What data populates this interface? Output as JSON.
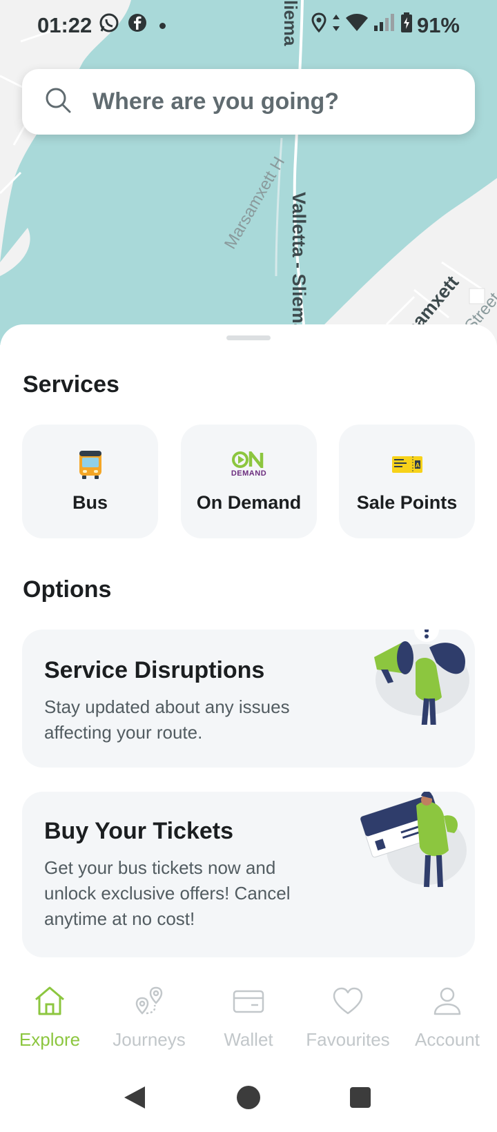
{
  "status_bar": {
    "time": "01:22",
    "battery": "91%",
    "icons": [
      "whatsapp-icon",
      "facebook-icon",
      "location-icon",
      "data-arrows-icon",
      "wifi-icon",
      "signal-icon",
      "battery-icon"
    ]
  },
  "map": {
    "labels": {
      "road_main": "Valletta - Sliema",
      "road_top": "liema",
      "harbour": "Marsamxett H",
      "district": "rsamxett",
      "street": "Street"
    }
  },
  "search": {
    "placeholder": "Where are you going?"
  },
  "services": {
    "title": "Services",
    "items": [
      {
        "label": "Bus",
        "icon": "bus-icon"
      },
      {
        "label": "On Demand",
        "icon": "on-demand-logo",
        "logo_top": "ON",
        "logo_bottom": "DEMAND"
      },
      {
        "label": "Sale Points",
        "icon": "ticket-icon"
      }
    ]
  },
  "options": {
    "title": "Options",
    "items": [
      {
        "title": "Service Disruptions",
        "description": "Stay updated about any issues affecting your route."
      },
      {
        "title": "Buy Your Tickets",
        "description": "Get your bus tickets now and unlock exclusive offers! Cancel anytime at no cost!"
      }
    ]
  },
  "bottom_nav": {
    "items": [
      {
        "label": "Explore",
        "icon": "home-icon",
        "active": true
      },
      {
        "label": "Journeys",
        "icon": "route-pins-icon",
        "active": false
      },
      {
        "label": "Wallet",
        "icon": "card-icon",
        "active": false
      },
      {
        "label": "Favourites",
        "icon": "heart-icon",
        "active": false
      },
      {
        "label": "Account",
        "icon": "user-icon",
        "active": false
      }
    ]
  },
  "colors": {
    "accent": "#8cc63f",
    "water": "#a9d9d9",
    "card_bg": "#f4f6f8",
    "inactive": "#c2c7ca"
  }
}
